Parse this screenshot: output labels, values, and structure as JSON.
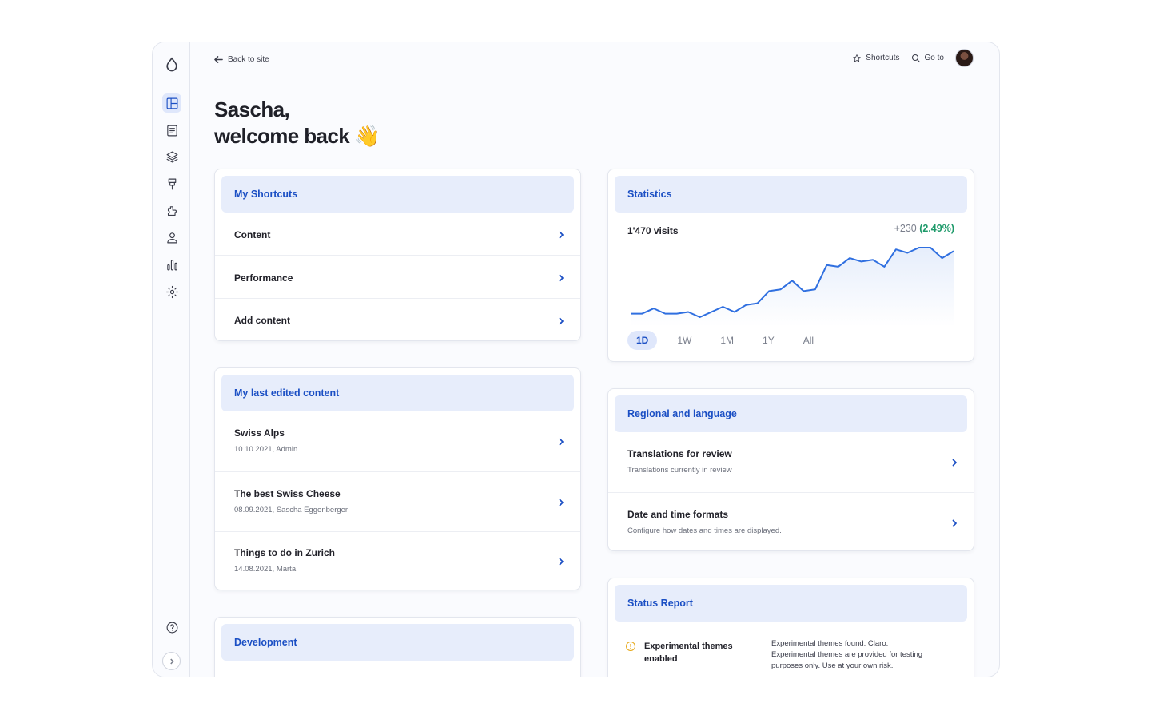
{
  "sidebar": {
    "icons": [
      "drupal-logo-icon",
      "dashboard-icon",
      "content-icon",
      "structure-icon",
      "appearance-icon",
      "extend-icon",
      "people-icon",
      "reports-icon",
      "configuration-icon",
      "help-icon",
      "expand-chevron-icon"
    ]
  },
  "topbar": {
    "back_label": "Back to site",
    "shortcuts_label": "Shortcuts",
    "goto_label": "Go to"
  },
  "welcome": {
    "line1": "Sascha,",
    "line2": "welcome back 👋"
  },
  "shortcuts": {
    "title": "My Shortcuts",
    "items": [
      "Content",
      "Performance",
      "Add content"
    ]
  },
  "last_edited": {
    "title": "My last edited content",
    "items": [
      {
        "title": "Swiss Alps",
        "meta": "10.10.2021, Admin"
      },
      {
        "title": "The best Swiss Cheese",
        "meta": "08.09.2021, Sascha Eggenberger"
      },
      {
        "title": "Things to do in Zurich",
        "meta": "14.08.2021, Marta"
      }
    ]
  },
  "development": {
    "title": "Development"
  },
  "statistics": {
    "title": "Statistics",
    "visits": "1'470 visits",
    "delta": "+230",
    "delta_pct": "(2.49%)",
    "tabs": [
      "1D",
      "1W",
      "1M",
      "1Y",
      "All"
    ],
    "active_tab": "1D",
    "line_color": "#2f6fe0"
  },
  "chart_data": {
    "type": "area",
    "values": [
      3,
      3,
      6,
      3,
      3,
      4,
      1,
      4,
      7,
      4,
      8,
      9,
      16,
      17,
      22,
      16,
      17,
      31,
      30,
      35,
      33,
      34,
      30,
      40,
      38,
      41,
      41,
      35,
      39
    ],
    "title": "",
    "xlabel": "",
    "ylabel": ""
  },
  "regional": {
    "title": "Regional and language",
    "items": [
      {
        "title": "Translations for review",
        "meta": "Translations currently in review"
      },
      {
        "title": "Date and time formats",
        "meta": "Configure how dates and times are displayed."
      }
    ]
  },
  "status": {
    "title": "Status Report",
    "item_title_1": "Experimental themes",
    "item_title_2": "enabled",
    "desc_1": "Experimental themes found: Claro.",
    "desc_2": "Experimental themes are provided for testing",
    "desc_3": "purposes only. Use at your own risk."
  },
  "colors": {
    "accent": "#1b4fc4",
    "header_bg": "#e7edfb",
    "positive": "#1e9a6a",
    "warning": "#e6a817"
  }
}
